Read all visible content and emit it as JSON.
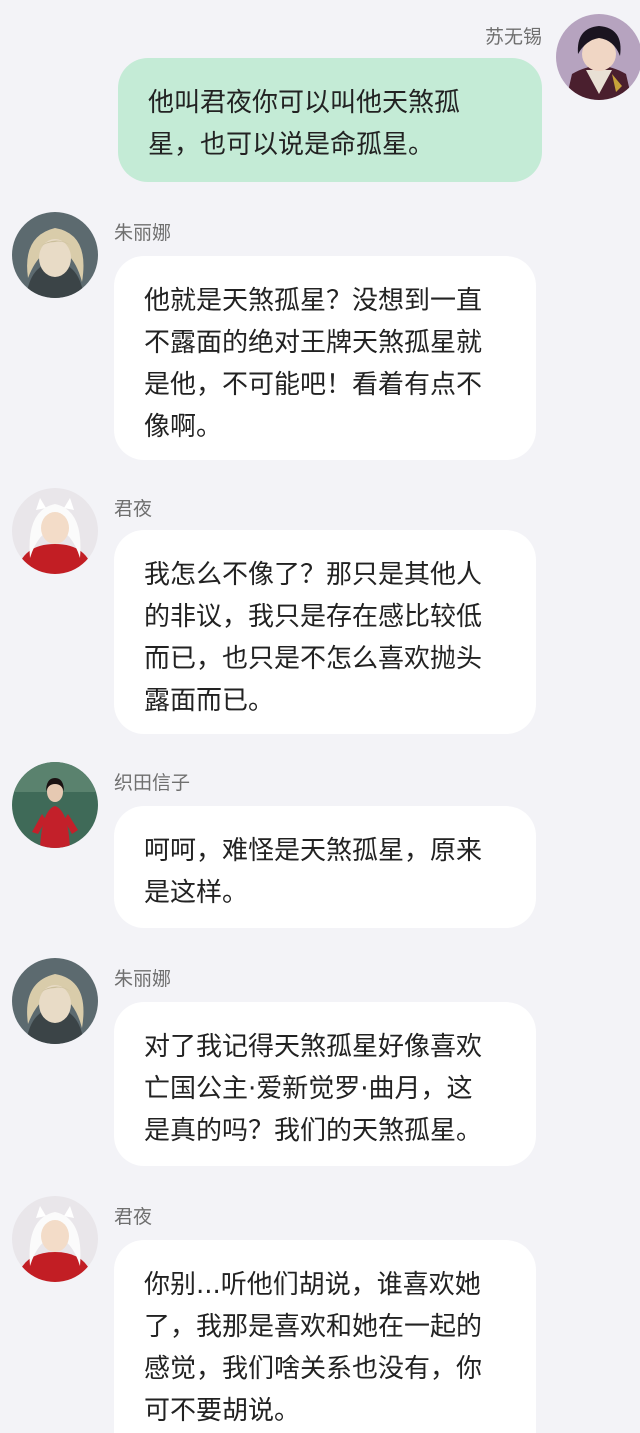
{
  "messages": [
    {
      "sender": "苏无锡",
      "direction": "outgoing",
      "avatar_icon": "lelouch-avatar-icon",
      "text": "他叫君夜你可以叫他天煞孤\n星，也可以说是命孤星。"
    },
    {
      "sender": "朱丽娜",
      "direction": "incoming",
      "avatar_icon": "blonde-woman-avatar-icon",
      "text": "他就是天煞孤星？没想到一直\n不露面的绝对王牌天煞孤星就\n是他，不可能吧！看着有点不\n像啊。"
    },
    {
      "sender": "君夜",
      "direction": "incoming",
      "avatar_icon": "inuyasha-avatar-icon",
      "text": "我怎么不像了？那只是其他人\n的非议，我只是存在感比较低\n而已，也只是不怎么喜欢抛头\n露面而已。"
    },
    {
      "sender": "织田信子",
      "direction": "incoming",
      "avatar_icon": "red-dress-woman-avatar-icon",
      "text": "呵呵，难怪是天煞孤星，原来\n是这样。"
    },
    {
      "sender": "朱丽娜",
      "direction": "incoming",
      "avatar_icon": "blonde-woman-avatar-icon",
      "text": "对了我记得天煞孤星好像喜欢\n亡国公主·爱新觉罗·曲月，这\n是真的吗？我们的天煞孤星。"
    },
    {
      "sender": "君夜",
      "direction": "incoming",
      "avatar_icon": "inuyasha-avatar-icon",
      "text": "你别...听他们胡说，谁喜欢她\n了，我那是喜欢和她在一起的\n感觉，我们啥关系也没有，你\n可不要胡说。"
    }
  ],
  "colors": {
    "background": "#f3f3f7",
    "incoming_bubble": "#ffffff",
    "outgoing_bubble": "#c4ebd6"
  }
}
